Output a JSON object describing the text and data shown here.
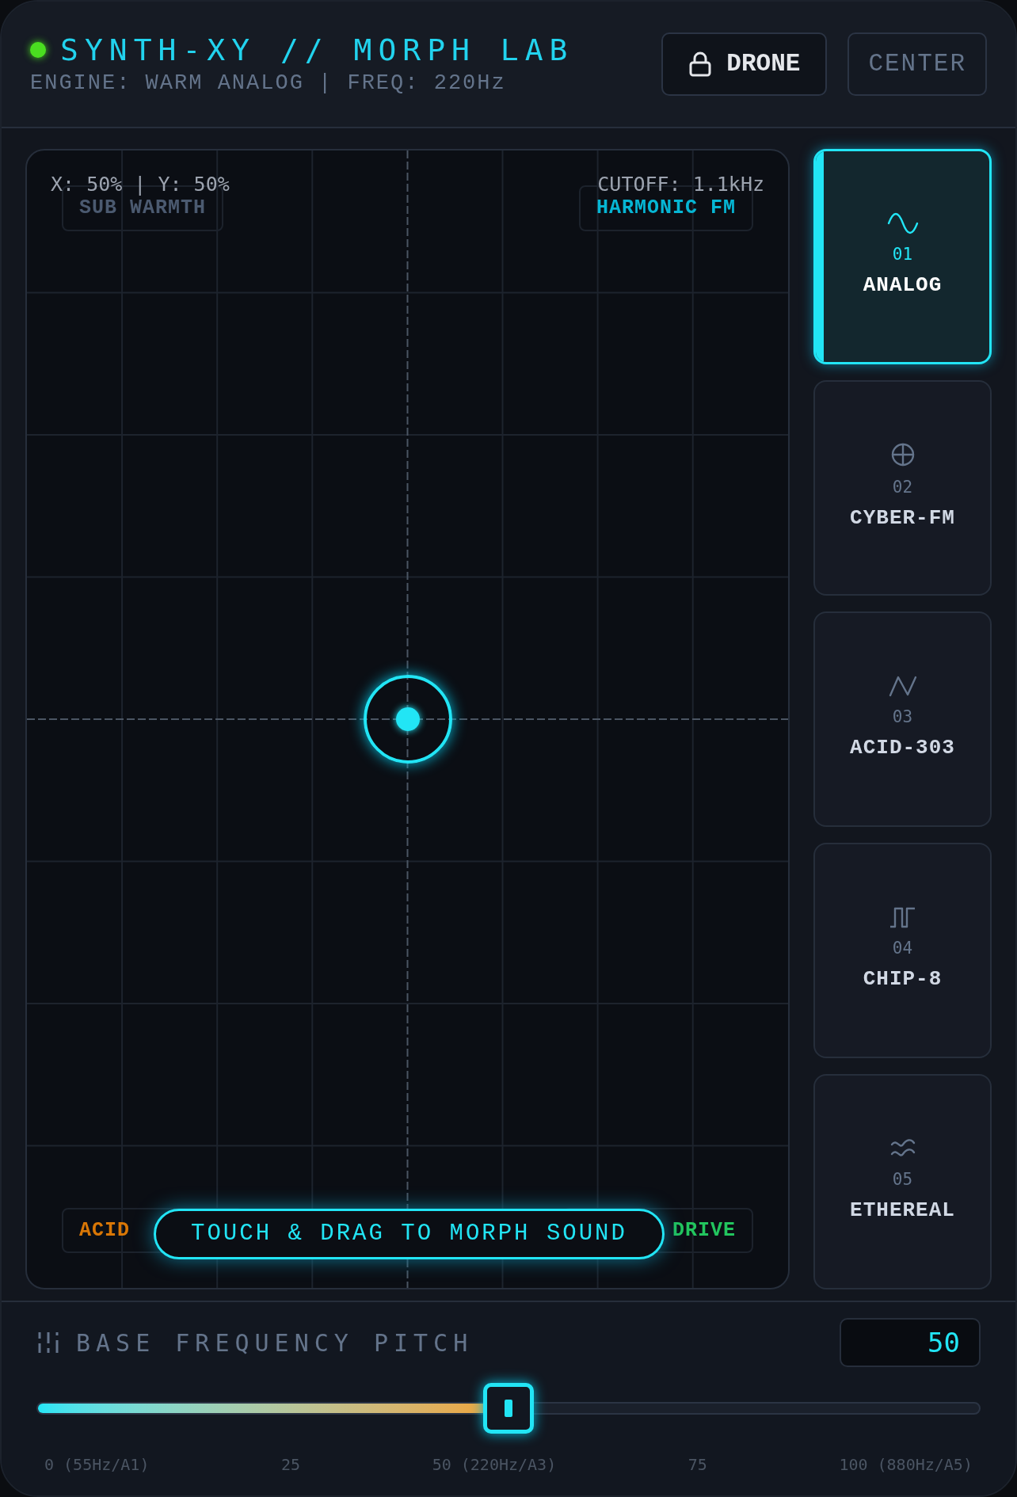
{
  "header": {
    "live": true,
    "title": "SYNTH-XY // MORPH LAB",
    "subtitle": "ENGINE: WARM ANALOG | FREQ: 220Hz",
    "buttons": [
      {
        "label": "DRONE",
        "kind": "lock"
      },
      {
        "label": "CENTER",
        "kind": "plain"
      }
    ]
  },
  "pad": {
    "readouts": [
      "X: 50% | Y: 50%",
      "CUTOFF: 1.1kHz"
    ],
    "corners": [
      {
        "label": "SUB WARMTH",
        "color": "#4b5a70"
      },
      {
        "label": "HARMONIC FM",
        "color": "#06b6d4"
      },
      {
        "label": "ACID",
        "color": "#d97706"
      },
      {
        "label": "DRIVE",
        "color": "#22c55e"
      }
    ],
    "hint": "TOUCH & DRAG TO MORPH SOUND"
  },
  "modes": [
    {
      "number": "01",
      "name": "ANALOG",
      "kind": "sine",
      "selected": true
    },
    {
      "number": "02",
      "name": "CYBER-FM",
      "kind": "orbit",
      "selected": false
    },
    {
      "number": "03",
      "name": "ACID-303",
      "kind": "saw",
      "selected": false
    },
    {
      "number": "04",
      "name": "CHIP-8",
      "kind": "square",
      "selected": false
    },
    {
      "number": "05",
      "name": "ETHEREAL",
      "kind": "waves",
      "selected": false
    }
  ],
  "pitch": {
    "label": "BASE FREQUENCY PITCH",
    "value": "50",
    "level": 0.5,
    "ticks": [
      "0 (55Hz/A1)",
      "25",
      "50 (220Hz/A3)",
      "75",
      "100 (880Hz/A5)"
    ]
  }
}
